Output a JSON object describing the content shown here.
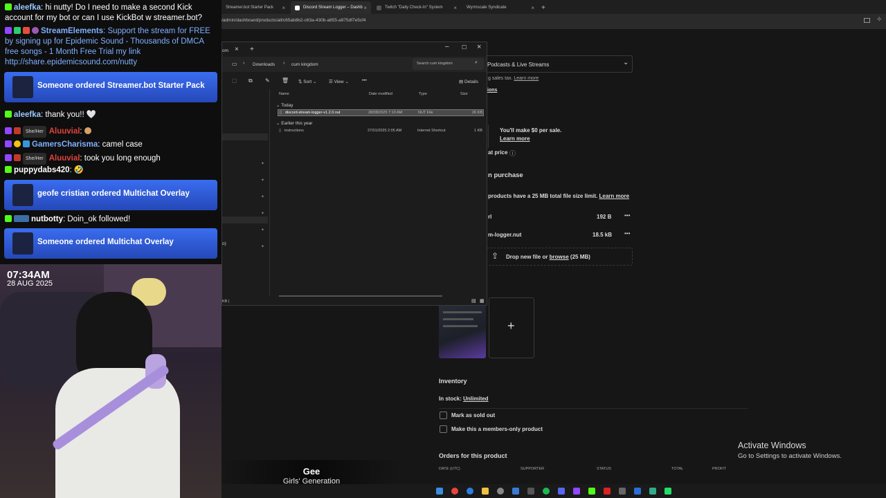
{
  "browser": {
    "tabs": [
      {
        "label": "Streamer.bot Starter Pack",
        "active": false
      },
      {
        "label": "Discord Stream Logger – Dashb",
        "active": true
      },
      {
        "label": "Twitch \"Daily Check-In\" System",
        "active": false
      },
      {
        "label": "Wyrmscale Syndicate",
        "active": false
      }
    ],
    "new_tab": "+",
    "url": "/admin/dashboard/products/all/c65ab8b2-c63a-430b-a855-a975df7e5cf4"
  },
  "page": {
    "category_value": "Podcasts & Live Streams",
    "tax_note": "g sales tax.",
    "tax_learn_more": "Learn more",
    "options_link": "ions",
    "earn_title": "You'll make $0 per sale.",
    "earn_learn_more": "Learn more",
    "price_label": "at price",
    "purchase_title": "n purchase",
    "file_limit_text": "products have a 25 MB total file size limit.",
    "file_limit_learn_more": "Learn more",
    "files": [
      {
        "name": "rl",
        "size": "192 B"
      },
      {
        "name": "m-logger.nut",
        "size": "18.5 kB"
      }
    ],
    "more_icon": "•••",
    "dropzone_text_1": "Drop new file or ",
    "dropzone_browse": "browse",
    "dropzone_text_2": " (25 MB)",
    "add_image": "+",
    "inventory_title": "Inventory",
    "in_stock_label": "In stock: ",
    "in_stock_value": "Unlimited",
    "mark_sold_out": "Mark as sold out",
    "members_only": "Make this a members-only product",
    "orders_title": "Orders for this product",
    "orders_columns": [
      "DATE (UTC)",
      "SUPPORTER",
      "STATUS",
      "TOTAL",
      "PROFIT"
    ],
    "activate_title": "Activate Windows",
    "activate_sub": "Go to Settings to activate Windows."
  },
  "explorer": {
    "tab_partial": "om",
    "breadcrumb": [
      "Downloads",
      "cum kingdom"
    ],
    "search_placeholder": "Search cum kingdom",
    "toolbar": {
      "sort": "Sort",
      "view": "View",
      "more": "•••",
      "details": "Details"
    },
    "columns": [
      "Name",
      "Date modified",
      "Type",
      "Size"
    ],
    "groups": [
      {
        "label": "Today",
        "items": [
          {
            "name": "discord-stream-logger-v1.2.0.nut",
            "date": "28/08/2025 7:10 AM",
            "type": "NUT File",
            "size": "26 KB",
            "selected": true
          }
        ]
      },
      {
        "label": "Earlier this year",
        "items": [
          {
            "name": "instructions",
            "date": "27/01/2025 2:05 AM",
            "type": "Internet Shortcut",
            "size": "1 KB",
            "selected": false
          }
        ]
      }
    ],
    "status_partial": "KB |",
    "side_partial": "o)"
  },
  "chat": {
    "messages": [
      {
        "user": "aleefka",
        "color": "#9bc7ff",
        "text": ": hi nutty! Do I need to make a second Kick account for my bot or can I use KickBot w streamer.bot?"
      },
      {
        "user": "StreamElements",
        "color": "#7fb0ff",
        "text": ": Support the stream for FREE by signing up for Epidemic Sound - Thousands of DMCA free songs - 1 Month Free Trial my link http://share.epidemicsound.com/nutty"
      },
      {
        "user": "aleefka",
        "color": "#9bc7ff",
        "text": ": thank you!! 🤍"
      },
      {
        "user": "Aluuvial",
        "pronoun": "She/Her",
        "color": "#e0443c",
        "text": ": "
      },
      {
        "user": "GamersCharisma",
        "color": "#7fb0ff",
        "text": ": camel case"
      },
      {
        "user": "Aluuvial",
        "pronoun": "She/Her",
        "color": "#e0443c",
        "text": ": took you long enough"
      },
      {
        "user": "puppydabs420",
        "color": "#ffffff",
        "text": ": 🤣"
      },
      {
        "user": "nutbotty",
        "color": "#ffffff",
        "text": ": Doin_ok followed!"
      }
    ],
    "alerts": [
      "Someone ordered Streamer.bot Starter Pack",
      "geofe cristian ordered Multichat Overlay",
      "Someone ordered Multichat Overlay"
    ]
  },
  "webcam": {
    "time": "07:34AM",
    "date": "28 AUG 2025"
  },
  "now_playing": {
    "title": "Gee",
    "artist": "Girls' Generation"
  },
  "colors": {
    "accent_blue": "#3a6df0",
    "page_bg": "#161616",
    "link": "#ffffff"
  }
}
